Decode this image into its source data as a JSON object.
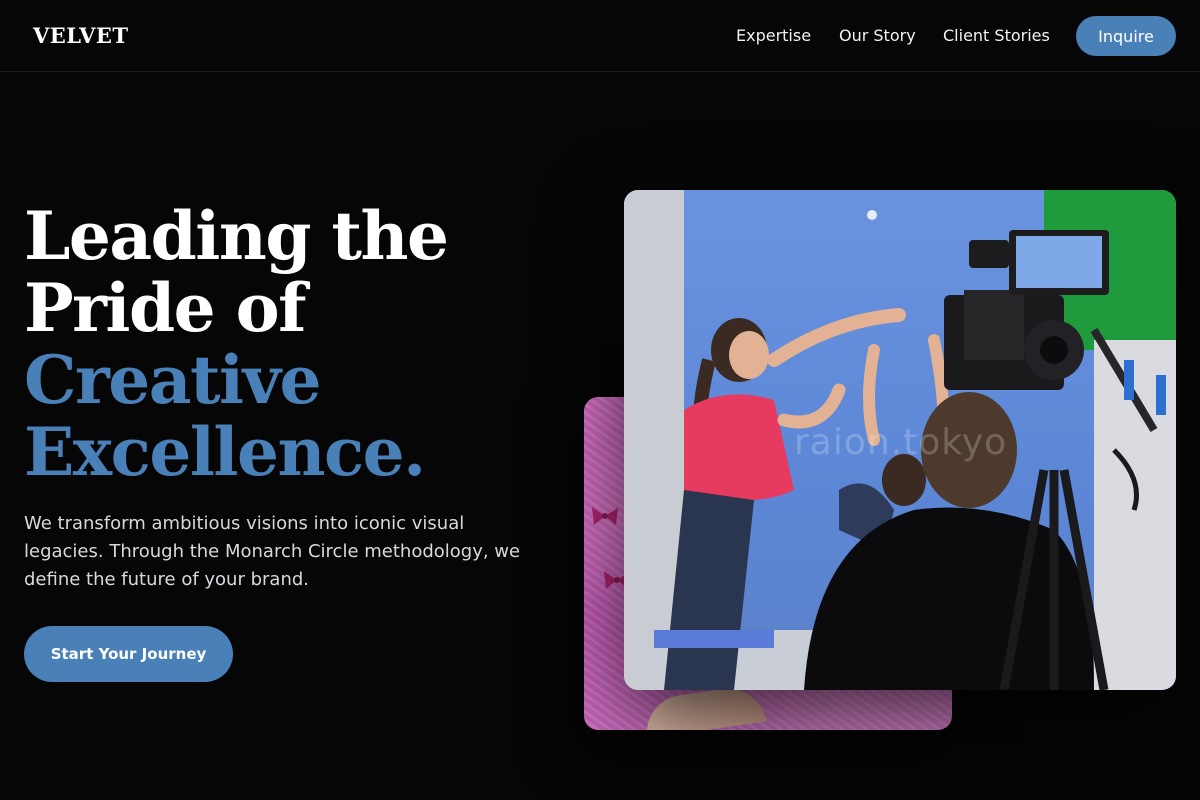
{
  "header": {
    "logo": "VELVET",
    "nav": [
      {
        "label": "Expertise"
      },
      {
        "label": "Our Story"
      },
      {
        "label": "Client Stories"
      }
    ],
    "inquire_label": "Inquire"
  },
  "hero": {
    "title_lines": [
      "Leading the",
      "Pride of",
      "Creative",
      "Excellence."
    ],
    "description": "We transform ambitious visions into iconic visual legacies. Through the Monarch Circle methodology, we define the future of your brand.",
    "cta_label": "Start Your Journey",
    "image_watermark": "raion.tokyo"
  },
  "colors": {
    "background": "#060607",
    "accent": "#4a80b8",
    "text": "#ffffff",
    "muted_text": "#d8d9de"
  }
}
